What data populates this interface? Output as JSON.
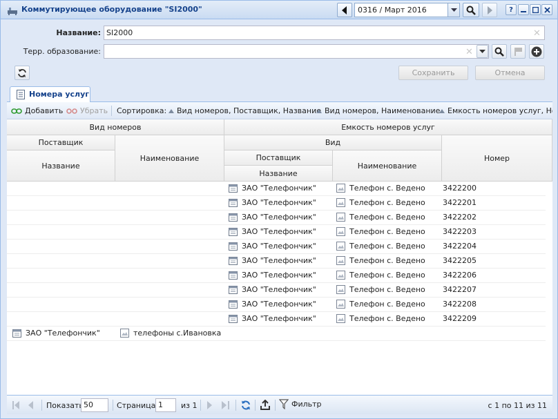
{
  "window": {
    "title": "Коммутирующее оборудование \"SI2000\"",
    "period": "0316 / Март 2016"
  },
  "form": {
    "name_label": "Название:",
    "name_value": "SI2000",
    "terr_label": "Терр. образование:",
    "terr_value": "",
    "save_label": "Сохранить",
    "cancel_label": "Отмена"
  },
  "tab": {
    "label": "Номера услуг"
  },
  "toolbar": {
    "add_label": "Добавить",
    "remove_label": "Убрать",
    "sort_label": "Сортировка:",
    "sort1": "Вид номеров, Поставщик, Название",
    "sort2": "Вид номеров, Наименование",
    "sort3": "Емкость номеров услуг, Ном"
  },
  "grid_header": {
    "vid_nomerov": "Вид номеров",
    "emkost": "Емкость номеров услуг",
    "postavshchik": "Поставщик",
    "naimenovanie": "Наименование",
    "nazvanie": "Название",
    "vid": "Вид",
    "postavshchik2": "Поставщик",
    "nazvanie2": "Название",
    "naimenovanie2": "Наименование",
    "nomer": "Номер"
  },
  "rows": [
    {
      "supplier": "ЗАО \"Телефончик\"",
      "name": "Телефон с. Ведено",
      "number": "3422200"
    },
    {
      "supplier": "ЗАО \"Телефончик\"",
      "name": "Телефон с. Ведено",
      "number": "3422201"
    },
    {
      "supplier": "ЗАО \"Телефончик\"",
      "name": "Телефон с. Ведено",
      "number": "3422202"
    },
    {
      "supplier": "ЗАО \"Телефончик\"",
      "name": "Телефон с. Ведено",
      "number": "3422203"
    },
    {
      "supplier": "ЗАО \"Телефончик\"",
      "name": "Телефон с. Ведено",
      "number": "3422204"
    },
    {
      "supplier": "ЗАО \"Телефончик\"",
      "name": "Телефон с. Ведено",
      "number": "3422205"
    },
    {
      "supplier": "ЗАО \"Телефончик\"",
      "name": "Телефон с. Ведено",
      "number": "3422206"
    },
    {
      "supplier": "ЗАО \"Телефончик\"",
      "name": "Телефон с. Ведено",
      "number": "3422207"
    },
    {
      "supplier": "ЗАО \"Телефончик\"",
      "name": "Телефон с. Ведено",
      "number": "3422208"
    },
    {
      "supplier": "ЗАО \"Телефончик\"",
      "name": "Телефон с. Ведено",
      "number": "3422209"
    }
  ],
  "last_row": {
    "supplier": "ЗАО \"Телефончик\"",
    "name": "телефоны с.Ивановка"
  },
  "paging": {
    "show_label": "Показать",
    "page_size": "50",
    "page_label": "Страница",
    "page_value": "1",
    "of_label": "из 1",
    "filter_label": "Фильтр",
    "summary": "с 1 по 11 из 11"
  },
  "colors": {
    "title_text": "#15428b",
    "window_bg": "#dfe8f6",
    "border": "#99bbe8"
  }
}
